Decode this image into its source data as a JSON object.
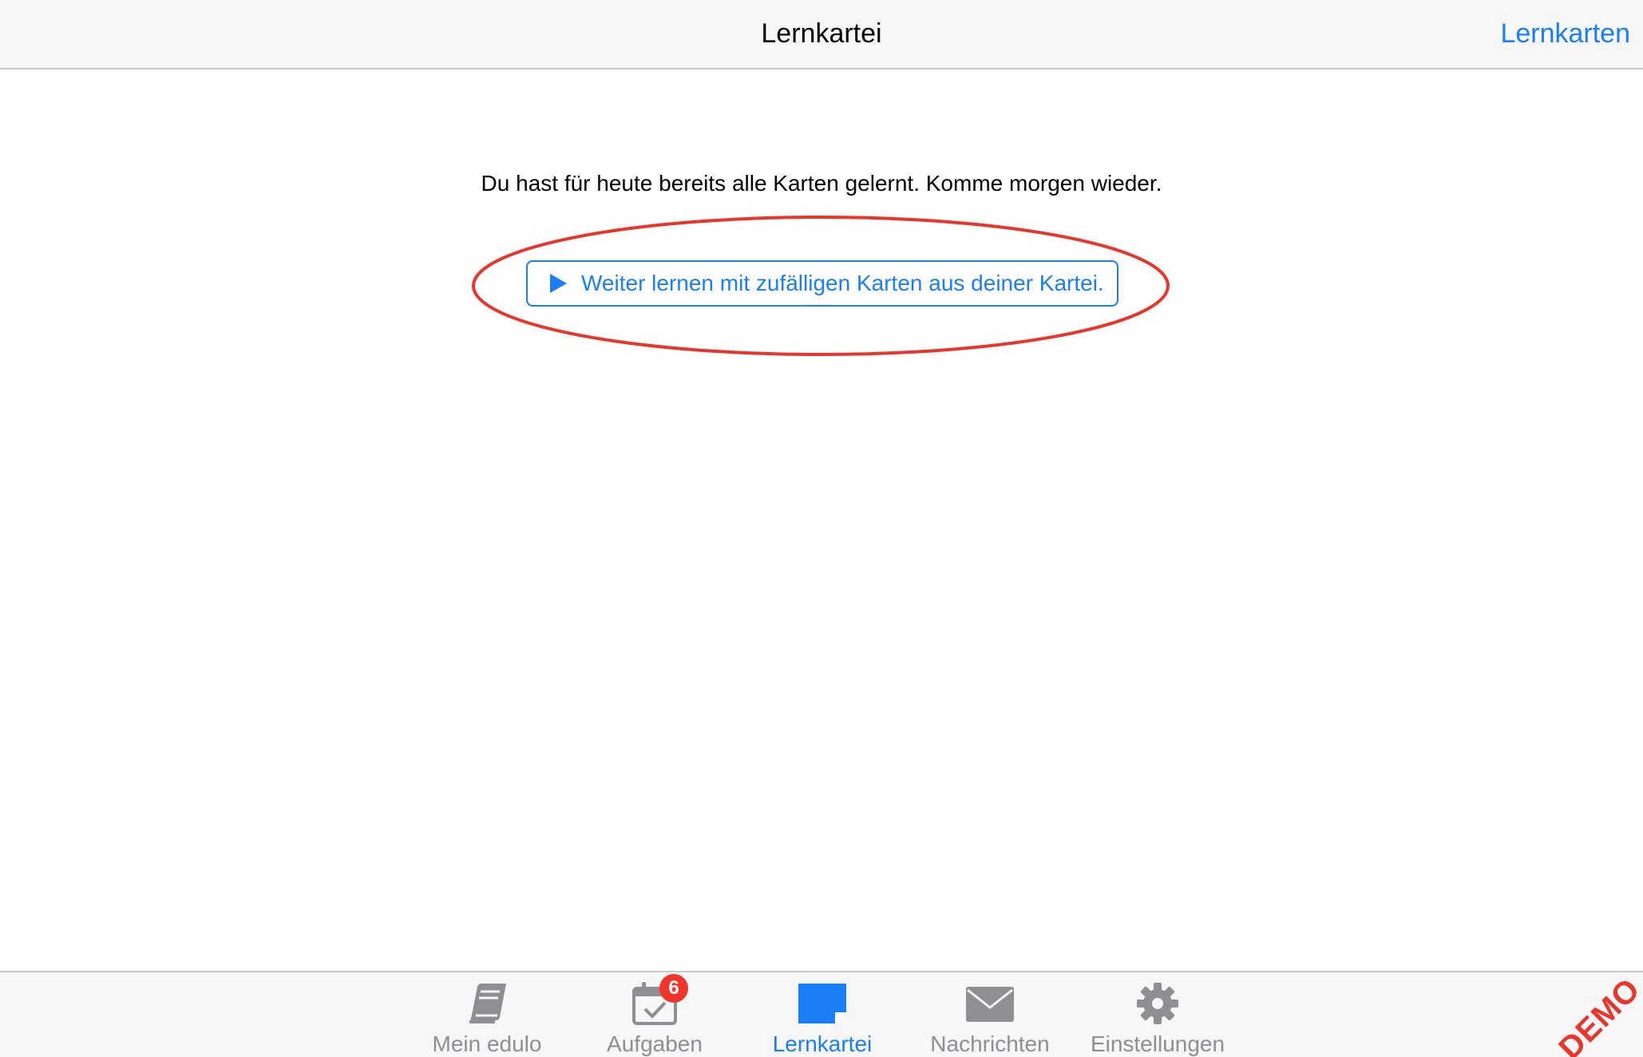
{
  "header": {
    "title": "Lernkartei",
    "right_button_label": "Lernkarten"
  },
  "main": {
    "message": "Du hast für heute bereits alle Karten gelernt. Komme morgen wieder.",
    "continue_button_label": "Weiter lernen mit zufälligen Karten aus deiner Kartei."
  },
  "tabbar": {
    "tabs": [
      {
        "label": "Mein edulo",
        "icon": "book-icon",
        "active": false
      },
      {
        "label": "Aufgaben",
        "icon": "calendar-check-icon",
        "active": false,
        "badge": "6"
      },
      {
        "label": "Lernkartei",
        "icon": "flashcard-icon",
        "active": true
      },
      {
        "label": "Nachrichten",
        "icon": "envelope-icon",
        "active": false
      },
      {
        "label": "Einstellungen",
        "icon": "gear-icon",
        "active": false
      }
    ]
  },
  "watermark": "DEMO",
  "colors": {
    "accent": "#1a7ef6",
    "inactive": "#8e8e93",
    "badge": "#f2352a",
    "annotation": "#e8362c"
  }
}
